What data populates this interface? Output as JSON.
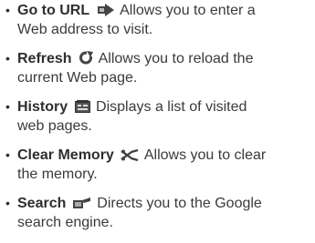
{
  "items": [
    {
      "term": "Go to URL",
      "icon": "arrow-right-icon",
      "desc_line1": "Allows you to enter a",
      "desc_line2": "Web address to visit."
    },
    {
      "term": "Refresh",
      "icon": "refresh-icon",
      "desc_line1": "Allows you to reload the",
      "desc_line2": "current Web page."
    },
    {
      "term": "History",
      "icon": "history-icon",
      "desc_line1": "Displays a list of visited",
      "desc_line2": "web pages."
    },
    {
      "term": "Clear Memory",
      "icon": "clear-memory-icon",
      "desc_line1": "Allows you to clear",
      "desc_line2": "the memory."
    },
    {
      "term": "Search",
      "icon": "search-icon",
      "desc_line1": "Directs you to the Google",
      "desc_line2": "search engine."
    }
  ],
  "bullet": "•"
}
